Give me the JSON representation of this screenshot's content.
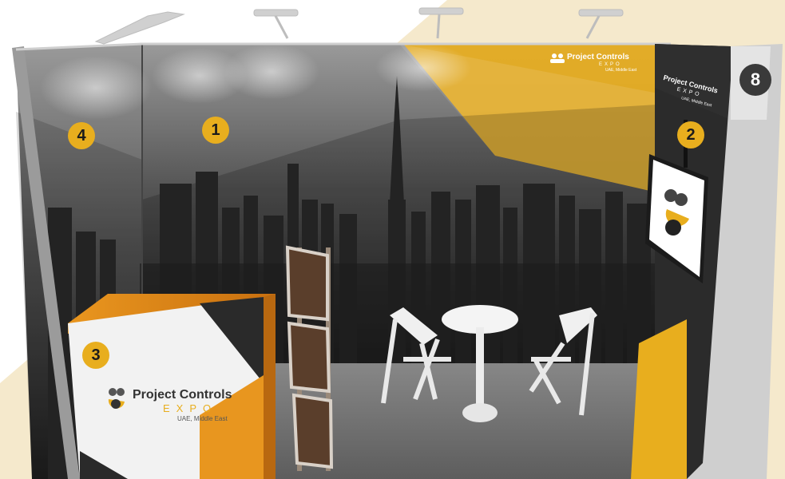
{
  "scene": "exhibition-booth-render",
  "colors": {
    "accent": "#E8AE1E",
    "background_tint": "#F5E9CC",
    "wall_dark": "#2a2a2a",
    "floor": "#6f6f6f",
    "counter_orange": "#E98A1E",
    "badge_dark": "#3a3a3a"
  },
  "markers": {
    "m1": "1",
    "m2": "2",
    "m3": "3",
    "m4": "4",
    "m8": "8"
  },
  "logo": {
    "name": "Project Controls",
    "expo": "EXPO",
    "location": "UAE, Middle East"
  },
  "back_wall_logo": {
    "name": "Project Controls",
    "expo": "EXPO",
    "location": "UAE, Middle East"
  },
  "tower_logo": {
    "name": "Project Controls",
    "expo": "EXPO",
    "location": "UAE, Middle East"
  }
}
